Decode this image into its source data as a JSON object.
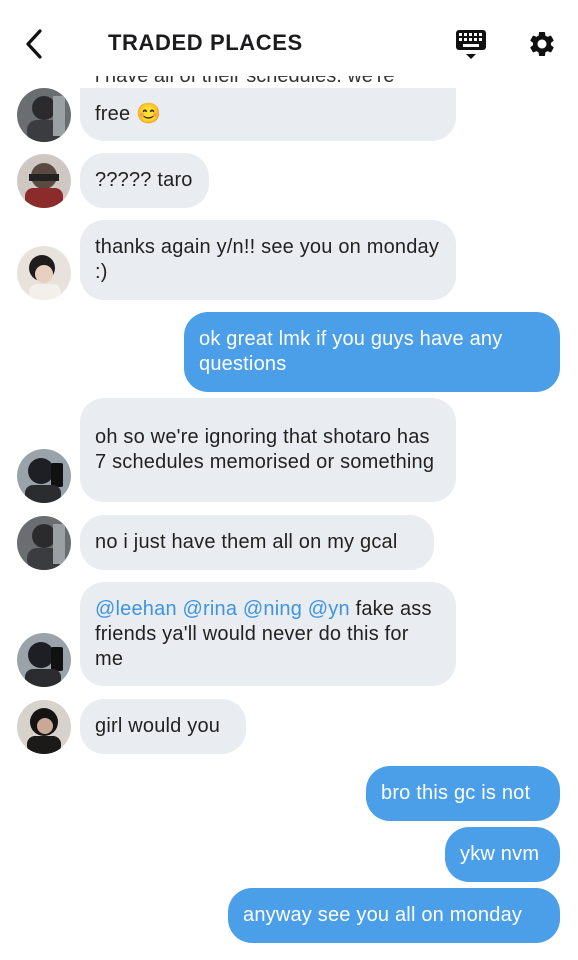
{
  "header": {
    "title": "TRADED PLACES"
  },
  "messages": {
    "m0_cut": "i have all of their schedules. we're",
    "m0": "free 😊",
    "m1": "????? taro",
    "m2": "thanks again y/n!! see you on monday :)",
    "m3": "ok great lmk if you guys have any questions",
    "m4": "oh so we're ignoring that shotaro has 7 schedules memorised or something",
    "m5": "no i just have them all on my gcal",
    "m6_mentions": "@leehan @rina @ning @yn",
    "m6_rest": " fake ass friends ya'll would never do this for me",
    "m7": "girl would you",
    "m8": "bro this gc is not",
    "m9": "ykw nvm",
    "m10": "anyway see you all on monday"
  },
  "colors": {
    "incoming_bubble": "#e9ecf1",
    "outgoing_bubble": "#4a9fe8",
    "mention": "#3d94e0"
  },
  "icons": {
    "back": "chevron-left-icon",
    "keyboard": "keyboard-icon",
    "settings": "gear-icon"
  }
}
